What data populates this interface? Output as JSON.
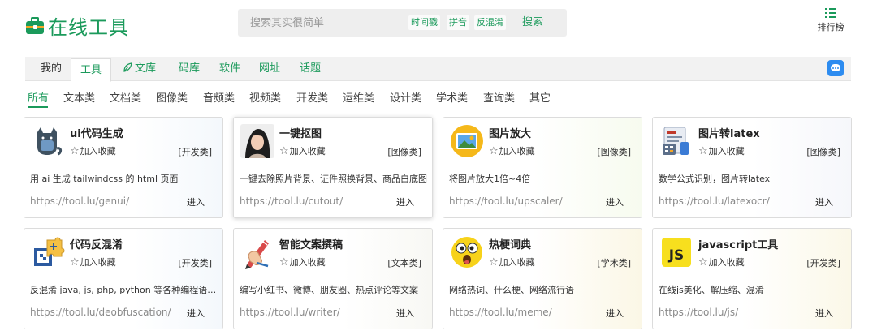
{
  "header": {
    "logo_text": "在线工具",
    "search_placeholder": "搜索其实很简单",
    "chips": [
      "时间戳",
      "拼音",
      "反混淆"
    ],
    "search_button": "搜索",
    "rank_label": "排行榜",
    "brand_color": "#1b9a5b"
  },
  "nav": {
    "items": [
      "我的",
      "工具",
      "文库",
      "码库",
      "软件",
      "网址",
      "话题"
    ],
    "active": "工具",
    "chat_icon": "chat-bubble-icon"
  },
  "categories": {
    "items": [
      "所有",
      "文本类",
      "文档类",
      "图像类",
      "音频类",
      "视频类",
      "开发类",
      "运维类",
      "设计类",
      "学术类",
      "查询类",
      "其它"
    ],
    "active": "所有"
  },
  "cards": [
    {
      "title": "ui代码生成",
      "fav": "加入收藏",
      "category": "[开发类]",
      "desc": "用 ai 生成 tailwindcss 的 html 页面",
      "url": "https://tool.lu/genui/",
      "go": "进入",
      "icon": "cat-icon"
    },
    {
      "title": "一键抠图",
      "fav": "加入收藏",
      "category": "[图像类]",
      "desc": "一键去除照片背景、证件照换背景、商品白底图",
      "url": "https://tool.lu/cutout/",
      "go": "进入",
      "icon": "portrait-icon"
    },
    {
      "title": "图片放大",
      "fav": "加入收藏",
      "category": "[图像类]",
      "desc": "将图片放大1倍~4倍",
      "url": "https://tool.lu/upscaler/",
      "go": "进入",
      "icon": "image-frame-icon"
    },
    {
      "title": "图片转latex",
      "fav": "加入收藏",
      "category": "[图像类]",
      "desc": "数学公式识别，图片转latex",
      "url": "https://tool.lu/latexocr/",
      "go": "进入",
      "icon": "formula-icon"
    },
    {
      "title": "代码反混淆",
      "fav": "加入收藏",
      "category": "[开发类]",
      "desc": "反混淆 java, js, php, python 等各种编程语言代码",
      "url": "https://tool.lu/deobfuscation/",
      "go": "进入",
      "icon": "puzzle-icon"
    },
    {
      "title": "智能文案撰稿",
      "fav": "加入收藏",
      "category": "[文本类]",
      "desc": "编写小红书、微博、朋友圈、热点评论等文案",
      "url": "https://tool.lu/writer/",
      "go": "进入",
      "icon": "pen-hand-icon"
    },
    {
      "title": "热梗词典",
      "fav": "加入收藏",
      "category": "[学术类]",
      "desc": "网络热词、什么梗、网络流行语",
      "url": "https://tool.lu/meme/",
      "go": "进入",
      "icon": "surprised-emoji-icon"
    },
    {
      "title": "javascript工具",
      "fav": "加入收藏",
      "category": "[开发类]",
      "desc": "在线js美化、解压缩、混淆",
      "url": "https://tool.lu/js/",
      "go": "进入",
      "icon": "js-icon"
    }
  ]
}
